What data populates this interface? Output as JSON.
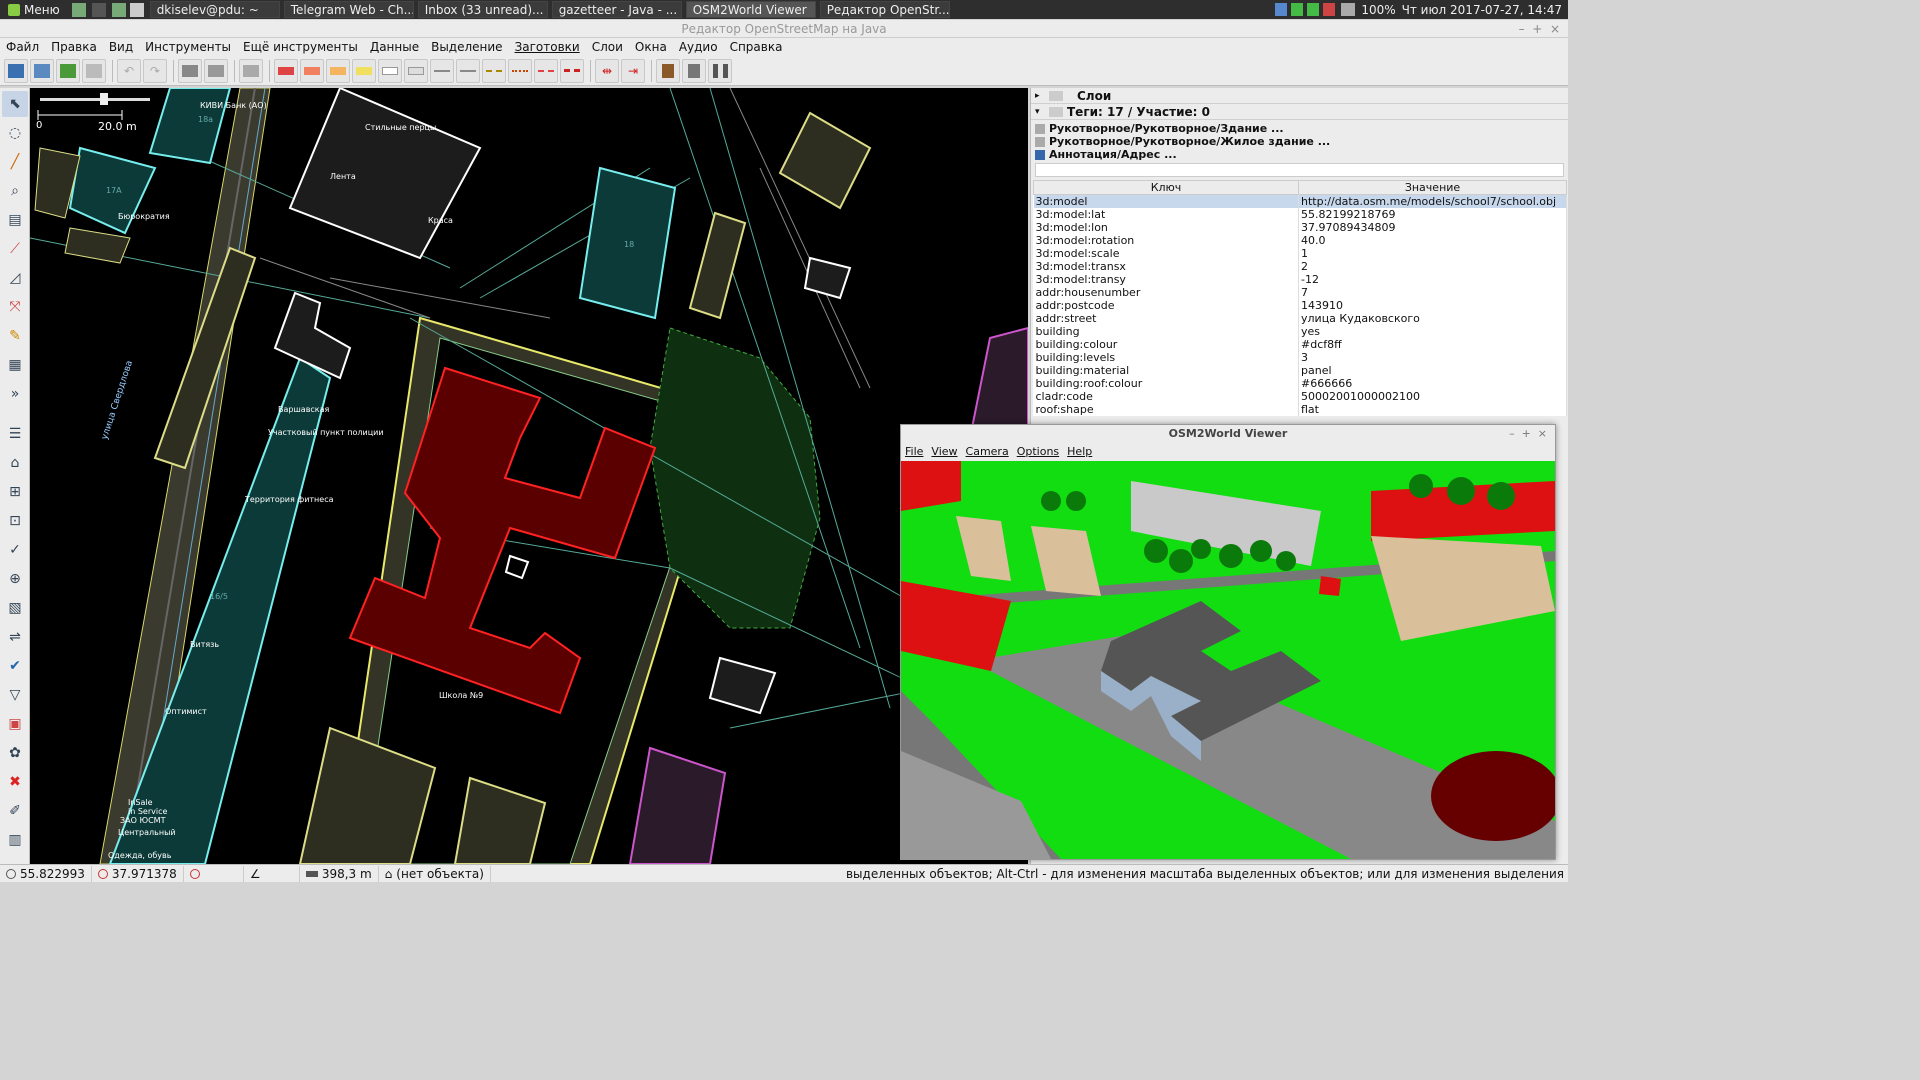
{
  "panel": {
    "menu": "Меню",
    "tasks": [
      "dkiselev@pdu: ~",
      "Telegram Web - Ch...",
      "Inbox (33 unread)...",
      "gazetteer - Java - ...",
      "OSM2World Viewer",
      "Редактор OpenStr..."
    ],
    "battery": "100%",
    "clock": "Чт июл 2017-07-27, 14:47"
  },
  "window": {
    "title": "Редактор OpenStreetMap на Java"
  },
  "menu": [
    "Файл",
    "Правка",
    "Вид",
    "Инструменты",
    "Ещё инструменты",
    "Данные",
    "Выделение",
    "Заготовки",
    "Слои",
    "Окна",
    "Аудио",
    "Справка"
  ],
  "map": {
    "scale_zero": "0",
    "scale_label": "20.0 m",
    "labels": {
      "bank": "КИВИ Банк (АО)",
      "stylish": "Стильные перцы",
      "lenta": "Лента",
      "krasa": "Краса",
      "bureau": "Бюрократия",
      "warsaw": "Варшавская",
      "police": "Участковый пункт полиции",
      "fitness": "Территория фитнеса",
      "vityaz": "Витязь",
      "optimist": "Оптимист",
      "school": "Школа №9",
      "insale": "InSale",
      "inservice": "in Service",
      "zao": "ЗАО ЮСМТ",
      "central": "Центральный",
      "clothes": "Одежда, обувь",
      "street": "улица Свердлова",
      "n17a": "17А",
      "n18a": "18а",
      "n18": "18",
      "n16": "16/5"
    }
  },
  "layers_panel": {
    "title": "Слои"
  },
  "tags_panel": {
    "title": "Теги: 17 / Участие: 0",
    "presets": [
      "Рукотворное/Рукотворное/Здание ...",
      "Рукотворное/Рукотворное/Жилое здание ...",
      "Аннотация/Адрес ..."
    ],
    "col_key": "Ключ",
    "col_value": "Значение",
    "rows": [
      {
        "k": "3d:model",
        "v": "http://data.osm.me/models/school7/school.obj"
      },
      {
        "k": "3d:model:lat",
        "v": "55.82199218769"
      },
      {
        "k": "3d:model:lon",
        "v": "37.97089434809"
      },
      {
        "k": "3d:model:rotation",
        "v": "40.0"
      },
      {
        "k": "3d:model:scale",
        "v": "1"
      },
      {
        "k": "3d:model:transx",
        "v": "2"
      },
      {
        "k": "3d:model:transy",
        "v": "-12"
      },
      {
        "k": "addr:housenumber",
        "v": "7"
      },
      {
        "k": "addr:postcode",
        "v": "143910"
      },
      {
        "k": "addr:street",
        "v": "улица Кудаковского"
      },
      {
        "k": "building",
        "v": "yes"
      },
      {
        "k": "building:colour",
        "v": "#dcf8ff"
      },
      {
        "k": "building:levels",
        "v": "3"
      },
      {
        "k": "building:material",
        "v": "panel"
      },
      {
        "k": "building:roof:colour",
        "v": "#666666"
      },
      {
        "k": "cladr:code",
        "v": "50002001000002100"
      },
      {
        "k": "roof:shape",
        "v": "flat"
      }
    ]
  },
  "osm2world": {
    "title": "OSM2World Viewer",
    "menu": [
      "File",
      "View",
      "Camera",
      "Options",
      "Help"
    ]
  },
  "status": {
    "lat": "55.822993",
    "lon": "37.971378",
    "dist": "398,3 m",
    "obj": "(нет объекта)",
    "hint": "выделенных объектов; Alt-Ctrl - для изменения масштаба выделенных объектов; или для изменения выделения"
  }
}
